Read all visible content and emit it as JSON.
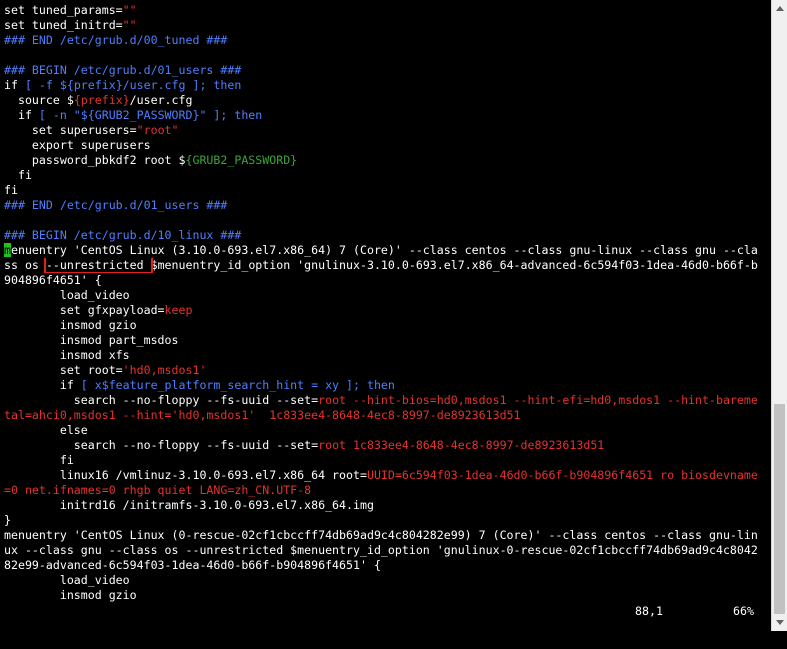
{
  "editor": {
    "lines": [
      [
        {
          "t": "set tuned_params=",
          "c": "white"
        },
        {
          "t": "\"\"",
          "c": "red"
        }
      ],
      [
        {
          "t": "set tuned_initrd=",
          "c": "white"
        },
        {
          "t": "\"\"",
          "c": "red"
        }
      ],
      [
        {
          "t": "### END /etc/grub.d/00_tuned ###",
          "c": "blue"
        }
      ],
      [
        {
          "t": "",
          "c": "white"
        }
      ],
      [
        {
          "t": "### BEGIN /etc/grub.d/01_users ###",
          "c": "blue"
        }
      ],
      [
        {
          "t": "if ",
          "c": "white"
        },
        {
          "t": "[ -f ${prefix}/user.cfg ]; then",
          "c": "blue"
        }
      ],
      [
        {
          "t": "  source $",
          "c": "white"
        },
        {
          "t": "{prefix}",
          "c": "red"
        },
        {
          "t": "/user.cfg",
          "c": "white"
        }
      ],
      [
        {
          "t": "  if ",
          "c": "white"
        },
        {
          "t": "[ -n \"${GRUB2_PASSWORD}\" ]; then",
          "c": "blue"
        }
      ],
      [
        {
          "t": "    set superusers=",
          "c": "white"
        },
        {
          "t": "\"root\"",
          "c": "red"
        }
      ],
      [
        {
          "t": "    export superusers",
          "c": "white"
        }
      ],
      [
        {
          "t": "    password_pbkdf2 root $",
          "c": "white"
        },
        {
          "t": "{GRUB2_PASSWORD}",
          "c": "green"
        }
      ],
      [
        {
          "t": "  fi",
          "c": "white"
        }
      ],
      [
        {
          "t": "fi",
          "c": "white"
        }
      ],
      [
        {
          "t": "### END /etc/grub.d/01_users ###",
          "c": "blue"
        }
      ],
      [
        {
          "t": "",
          "c": "white"
        }
      ],
      [
        {
          "t": "### BEGIN /etc/grub.d/10_linux ###",
          "c": "blue"
        }
      ],
      [
        {
          "t": "m",
          "c": "cursor"
        },
        {
          "t": "enuentry 'CentOS Linux (3.10.0-693.el7.x86_64) 7 (Core)' --class centos --class gnu-linux --class gnu --cla",
          "c": "white"
        }
      ],
      [
        {
          "t": "ss os ",
          "c": "white"
        },
        {
          "t": "--unrestricted ",
          "c": "hl"
        },
        {
          "t": "$menuentry_id_option 'gnulinux-3.10.0-693.el7.x86_64-advanced-6c594f03-1dea-46d0-b66f-b",
          "c": "white"
        }
      ],
      [
        {
          "t": "904896f4651' {",
          "c": "white"
        }
      ],
      [
        {
          "t": "        load_video",
          "c": "white"
        }
      ],
      [
        {
          "t": "        set gfxpayload=",
          "c": "white"
        },
        {
          "t": "keep",
          "c": "red"
        }
      ],
      [
        {
          "t": "        insmod gzio",
          "c": "white"
        }
      ],
      [
        {
          "t": "        insmod part_msdos",
          "c": "white"
        }
      ],
      [
        {
          "t": "        insmod xfs",
          "c": "white"
        }
      ],
      [
        {
          "t": "        set root=",
          "c": "white"
        },
        {
          "t": "'hd0,msdos1'",
          "c": "red"
        }
      ],
      [
        {
          "t": "        if ",
          "c": "white"
        },
        {
          "t": "[ x$feature_platform_search_hint = xy ]; then",
          "c": "blue"
        }
      ],
      [
        {
          "t": "          search --no-floppy --fs-uuid --set=",
          "c": "white"
        },
        {
          "t": "root --hint-bios=hd0,msdos1 --hint-efi=hd0,msdos1 --hint-bareme",
          "c": "red"
        }
      ],
      [
        {
          "t": "tal=ahci0,msdos1 --hint='hd0,msdos1'  1c833ee4-8648-4ec8-8997-de8923613d51",
          "c": "red"
        }
      ],
      [
        {
          "t": "        else",
          "c": "white"
        }
      ],
      [
        {
          "t": "          search --no-floppy --fs-uuid --set=",
          "c": "white"
        },
        {
          "t": "root 1c833ee4-8648-4ec8-8997-de8923613d51",
          "c": "red"
        }
      ],
      [
        {
          "t": "        fi",
          "c": "white"
        }
      ],
      [
        {
          "t": "        linux16 /vmlinuz-3.10.0-693.el7.x86_64 root=",
          "c": "white"
        },
        {
          "t": "UUID=6c594f03-1dea-46d0-b66f-b904896f4651 ro biosdevname",
          "c": "red"
        }
      ],
      [
        {
          "t": "=0 net.ifnames=0 rhgb quiet LANG=zh_CN.UTF-8",
          "c": "red"
        }
      ],
      [
        {
          "t": "        initrd16 /initramfs-3.10.0-693.el7.x86_64.img",
          "c": "white"
        }
      ],
      [
        {
          "t": "}",
          "c": "white"
        }
      ],
      [
        {
          "t": "menuentry 'CentOS Linux (0-rescue-02cf1cbccff74db69ad9c4c804282e99) 7 (Core)' --class centos --class gnu-lin",
          "c": "white"
        }
      ],
      [
        {
          "t": "ux --class gnu --class os --unrestricted $menuentry_id_option 'gnulinux-0-rescue-02cf1cbccff74db69ad9c4c8042",
          "c": "white"
        }
      ],
      [
        {
          "t": "82e99-advanced-6c594f03-1dea-46d0-b66f-b904896f4651' {",
          "c": "white"
        }
      ],
      [
        {
          "t": "        load_video",
          "c": "white"
        }
      ],
      [
        {
          "t": "        insmod gzio",
          "c": "white"
        }
      ]
    ],
    "colors": {
      "white": "#ffffff",
      "blue": "#4f7fff",
      "red": "#e5322d",
      "green": "#3aa53a",
      "cursor": "#22c022",
      "highlight_box": "#e02020",
      "background": "#000000"
    }
  },
  "statusbar": {
    "position": "88,1",
    "percent": "66%"
  },
  "scrollbar": {
    "up_icon": "arrow-up-icon",
    "down_icon": "arrow-down-icon",
    "scroll_fraction": 0.66
  }
}
